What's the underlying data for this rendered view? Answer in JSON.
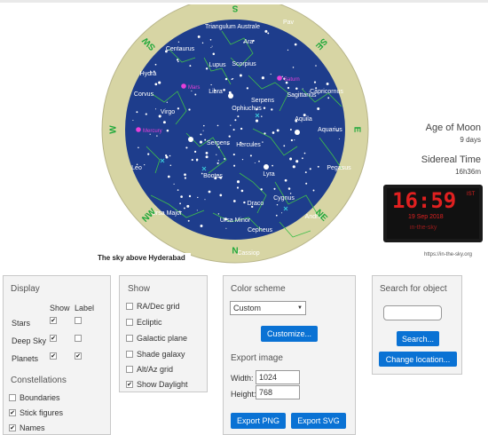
{
  "map": {
    "caption": "The sky above Hyderabad",
    "compass": [
      "N",
      "NE",
      "E",
      "SE",
      "S",
      "SW",
      "W",
      "NW"
    ],
    "constellations": [
      "Triangulum Australe",
      "Ara",
      "Centaurus",
      "Lupus",
      "Scorpius",
      "Hydra",
      "Corvus",
      "Libra",
      "Sagittarius",
      "Capricornus",
      "Serpens",
      "Ophiuchus",
      "Virgo",
      "Aquila",
      "Aquarius",
      "Serpens",
      "Hercules",
      "Leo",
      "Bootes",
      "Lyra",
      "Pegasus",
      "Cygnus",
      "Draco",
      "Ursa Major",
      "Ursa Minor",
      "Cepheus",
      "Andro",
      "Cassiop",
      "Pav"
    ],
    "planets": [
      "Mercury",
      "Saturn",
      "Mars"
    ],
    "colors": {
      "sky": "#1e3d8c",
      "ring": "#d7d5a4",
      "compass": "#1fa83a",
      "lines": "#3fbf4a",
      "planet": "#e83fd9"
    }
  },
  "moon": {
    "label": "Age of Moon",
    "value": "9 days"
  },
  "sidereal": {
    "label": "Sidereal Time",
    "value": "16h36m"
  },
  "clock": {
    "time": "16:59",
    "zone": "IST",
    "date": "19 Sep 2018",
    "tag": "in-the-sky",
    "color": "#e02020"
  },
  "credit": "https://in-the-sky.org",
  "display": {
    "title": "Display",
    "col_show": "Show",
    "col_label": "Label",
    "rows": [
      {
        "name": "Stars",
        "show": true,
        "label": false
      },
      {
        "name": "Deep Sky",
        "show": true,
        "label": false
      },
      {
        "name": "Planets",
        "show": true,
        "label": true
      }
    ],
    "constellations_title": "Constellations",
    "constellations": [
      {
        "name": "Boundaries",
        "checked": false
      },
      {
        "name": "Stick figures",
        "checked": true
      },
      {
        "name": "Names",
        "checked": true
      }
    ]
  },
  "show": {
    "title": "Show",
    "items": [
      {
        "name": "RA/Dec grid",
        "checked": false
      },
      {
        "name": "Ecliptic",
        "checked": false
      },
      {
        "name": "Galactic plane",
        "checked": false
      },
      {
        "name": "Shade galaxy",
        "checked": false
      },
      {
        "name": "Alt/Az grid",
        "checked": false
      },
      {
        "name": "Show Daylight",
        "checked": true
      }
    ]
  },
  "scheme": {
    "title": "Color scheme",
    "selected": "Custom",
    "customize": "Customize...",
    "export_title": "Export image",
    "width_label": "Width:",
    "width": "1024",
    "height_label": "Height:",
    "height": "768",
    "export_png": "Export PNG",
    "export_svg": "Export SVG"
  },
  "search": {
    "title": "Search for object",
    "value": "",
    "button": "Search...",
    "change": "Change location..."
  }
}
